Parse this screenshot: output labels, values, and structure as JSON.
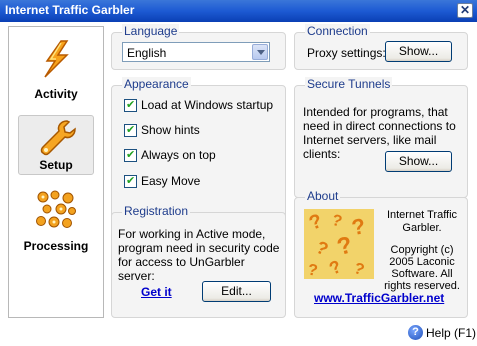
{
  "window": {
    "title": "Internet Traffic Garbler",
    "close_icon": "close-icon"
  },
  "sidebar": {
    "items": [
      {
        "label": "Activity",
        "icon": "lightning-icon"
      },
      {
        "label": "Setup",
        "icon": "wrench-icon",
        "active": true
      },
      {
        "label": "Processing",
        "icon": "gears-icon"
      }
    ]
  },
  "language": {
    "title": "Language",
    "selected": "English"
  },
  "appearance": {
    "title": "Appearance",
    "options": [
      {
        "label": "Load at Windows startup",
        "checked": true
      },
      {
        "label": "Show hints",
        "checked": true
      },
      {
        "label": "Always on top",
        "checked": true
      },
      {
        "label": "Easy Move",
        "checked": true
      }
    ]
  },
  "registration": {
    "title": "Registration",
    "text": "For working in Active mode, program need in security code for access to UnGarbler server:",
    "get_it": "Get it",
    "edit": "Edit..."
  },
  "connection": {
    "title": "Connection",
    "proxy_label": "Proxy settings:",
    "show": "Show..."
  },
  "tunnels": {
    "title": "Secure Tunnels",
    "text": "Intended for programs, that need in direct connections to Internet servers, like mail clients:",
    "show": "Show..."
  },
  "about": {
    "title": "About",
    "app_name": "Internet Traffic Garbler.",
    "copyright": "Copyright (c) 2005 Laconic Software. All rights reserved.",
    "url": "www.TrafficGarbler.net"
  },
  "status": {
    "help": "Help (F1)"
  },
  "colors": {
    "title_bar": "#1d5ad3",
    "group_title": "#1e3c8c",
    "link": "#0000cc"
  }
}
